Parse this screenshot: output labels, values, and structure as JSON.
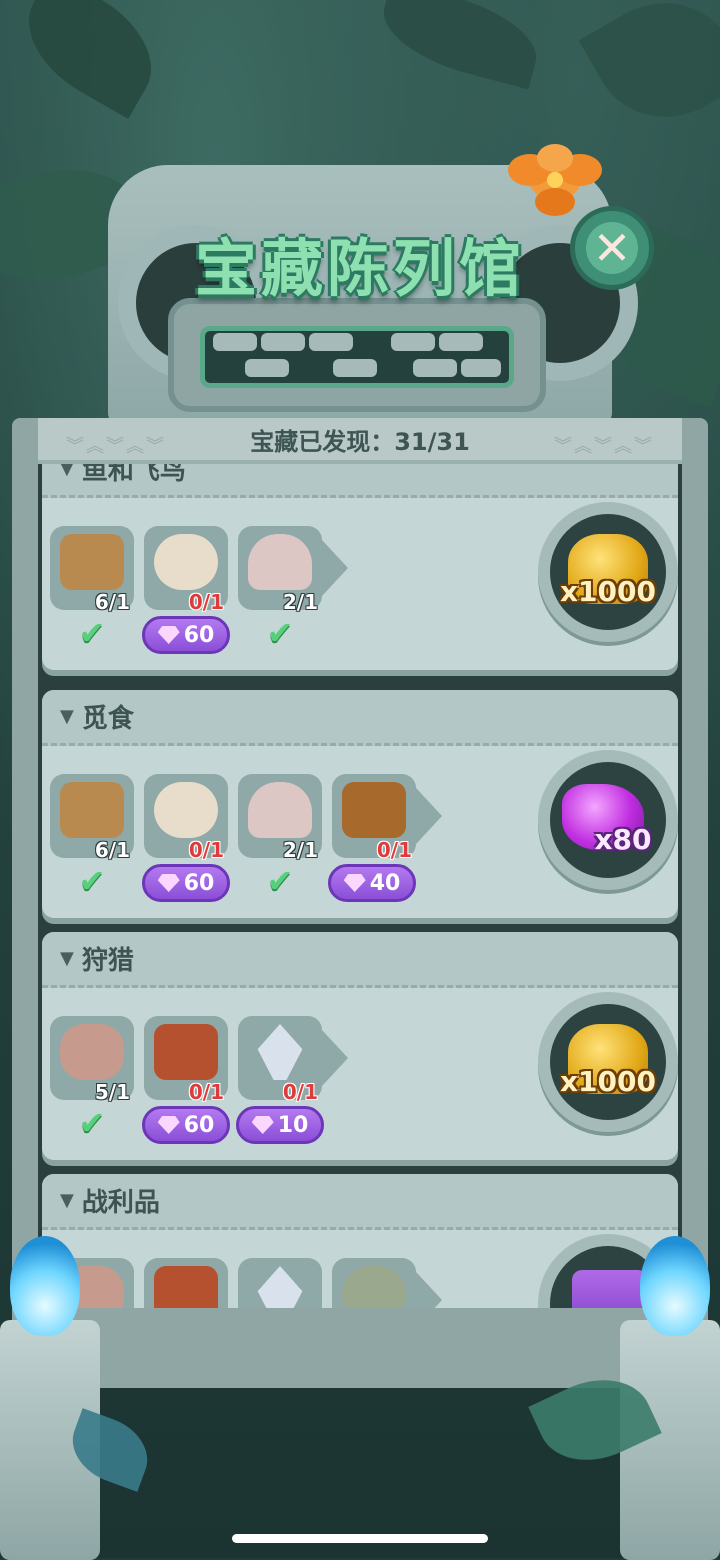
{
  "header": {
    "title": "宝藏陈列馆",
    "close_icon": "close-icon",
    "progress_label": "宝藏已发现：31/31"
  },
  "sections": [
    {
      "title": "鱼和飞鸟",
      "items": [
        {
          "icon": "fossil-tablet-icon",
          "count": "6/1",
          "status": "check"
        },
        {
          "icon": "bone-necklace-icon",
          "count": "0/1",
          "status": "gem",
          "cost": "60"
        },
        {
          "icon": "bird-skull-icon",
          "count": "2/1",
          "status": "check"
        }
      ],
      "reward": {
        "icon": "gold-coins-icon",
        "label": "x1000"
      }
    },
    {
      "title": "觅食",
      "items": [
        {
          "icon": "fossil-tablet-icon",
          "count": "6/1",
          "status": "check"
        },
        {
          "icon": "bone-necklace-icon",
          "count": "0/1",
          "status": "gem",
          "cost": "60"
        },
        {
          "icon": "bird-skull-icon",
          "count": "2/1",
          "status": "check"
        },
        {
          "icon": "wooden-binoculars-icon",
          "count": "0/1",
          "status": "gem",
          "cost": "40"
        }
      ],
      "reward": {
        "icon": "purple-gems-icon",
        "label": "x80"
      }
    },
    {
      "title": "狩猎",
      "items": [
        {
          "icon": "stone-axe-icon",
          "count": "5/1",
          "status": "check"
        },
        {
          "icon": "bone-shield-icon",
          "count": "0/1",
          "status": "gem",
          "cost": "60"
        },
        {
          "icon": "stone-spear-icon",
          "count": "0/1",
          "status": "gem",
          "cost": "10"
        }
      ],
      "reward": {
        "icon": "gold-coins-icon",
        "label": "x1000"
      }
    },
    {
      "title": "战利品",
      "items": [
        {
          "icon": "stone-axe-icon"
        },
        {
          "icon": "bone-shield-icon"
        },
        {
          "icon": "stone-spear-icon"
        },
        {
          "icon": "bead-necklace-icon"
        }
      ],
      "reward": {
        "icon": "gift-box-icon"
      }
    }
  ],
  "colors": {
    "check": "#56d07a",
    "gem_button": "#9a5fe3",
    "title_green": "#8fe0b0",
    "missing_count": "#e03b3b"
  }
}
